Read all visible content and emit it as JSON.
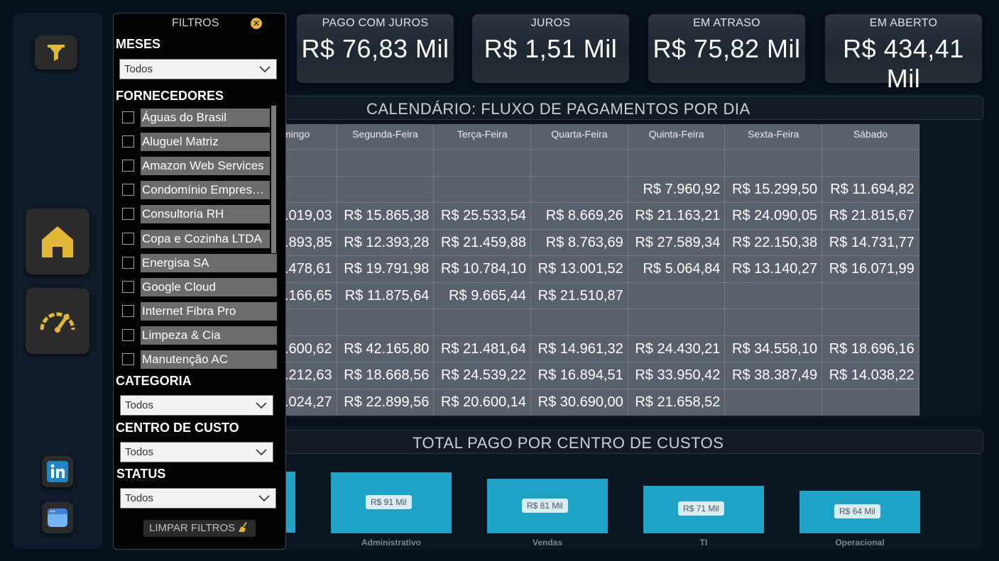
{
  "kpis": [
    {
      "title": "PAGO COM JUROS",
      "value": "R$ 76,83 Mil"
    },
    {
      "title": "JUROS",
      "value": "R$ 1,51 Mil"
    },
    {
      "title": "EM ATRASO",
      "value": "R$ 75,82 Mil"
    },
    {
      "title": "EM ABERTO",
      "value": "R$ 434,41 Mil"
    }
  ],
  "calendar": {
    "title": "CALENDÁRIO: FLUXO DE PAGAMENTOS POR DIA",
    "headers": [
      "mingo",
      "Segunda-Feira",
      "Terça-Feira",
      "Quarta-Feira",
      "Quinta-Feira",
      "Sexta-Feira",
      "Sábado"
    ],
    "rows": [
      [
        "",
        "",
        "",
        "",
        "",
        "",
        ""
      ],
      [
        "",
        "",
        "",
        "",
        "R$ 7.960,92",
        "R$ 15.299,50",
        "R$ 11.694,82"
      ],
      [
        ".019,03",
        "R$ 15.865,38",
        "R$ 25.533,54",
        "R$ 8.669,26",
        "R$ 21.163,21",
        "R$ 24.090,05",
        "R$ 21.815,67"
      ],
      [
        ".893,85",
        "R$ 12.393,28",
        "R$ 21.459,88",
        "R$ 8.763,69",
        "R$ 27.589,34",
        "R$ 22.150,38",
        "R$ 14.731,77"
      ],
      [
        ".478,61",
        "R$ 19.791,98",
        "R$ 10.784,10",
        "R$ 13.001,52",
        "R$ 5.064,84",
        "R$ 13.140,27",
        "R$ 16.071,99"
      ],
      [
        ".166,65",
        "R$ 11.875,64",
        "R$ 9.665,44",
        "R$ 21.510,87",
        "",
        "",
        ""
      ],
      [
        "",
        "",
        "",
        "",
        "",
        "",
        ""
      ],
      [
        ".600,62",
        "R$ 42.165,80",
        "R$ 21.481,64",
        "R$ 14.961,32",
        "R$ 24.430,21",
        "R$ 34.558,10",
        "R$ 18.696,16"
      ],
      [
        ".212,63",
        "R$ 18.668,56",
        "R$ 24.539,22",
        "R$ 16.894,51",
        "R$ 33.950,42",
        "R$ 38.387,49",
        "R$ 14.038,22"
      ],
      [
        ".024,27",
        "R$ 22.899,56",
        "R$ 20.600,14",
        "R$ 30.690,00",
        "R$ 21.658,52",
        "",
        ""
      ]
    ]
  },
  "chart_data": {
    "type": "bar",
    "title": "TOTAL PAGO POR CENTRO DE CUSTOS",
    "categories": [
      "Administrativo",
      "Vendas",
      "TI",
      "Operacional"
    ],
    "values": [
      91,
      81,
      71,
      64
    ],
    "data_labels": [
      "R$ 91 Mil",
      "R$ 81 Mil",
      "R$ 71 Mil",
      "R$ 64 Mil"
    ],
    "unit": "R$ Mil",
    "color": "#1fa2c6"
  },
  "filters": {
    "title": "FILTROS",
    "meses": {
      "label": "MESES",
      "value": "Todos"
    },
    "fornecedores": {
      "label": "FORNECEDORES",
      "items": [
        "Águas do Brasil",
        "Aluguel Matriz",
        "Amazon Web Services",
        "Condomínio Empresarial",
        "Consultoria RH",
        "Copa e Cozinha LTDA",
        "Energisa SA",
        "Google Cloud",
        "Internet Fibra Pro",
        "Limpeza & Cia",
        "Manutenção AC"
      ]
    },
    "categoria": {
      "label": "CATEGORIA",
      "value": "Todos"
    },
    "centro_custo": {
      "label": "CENTRO DE CUSTO",
      "value": "Todos"
    },
    "status": {
      "label": "STATUS",
      "value": "Todos"
    },
    "clear_label": "LIMPAR FILTROS"
  },
  "colors": {
    "accent": "#e0b53a",
    "bar": "#1fa2c6",
    "background": "#07111d"
  }
}
